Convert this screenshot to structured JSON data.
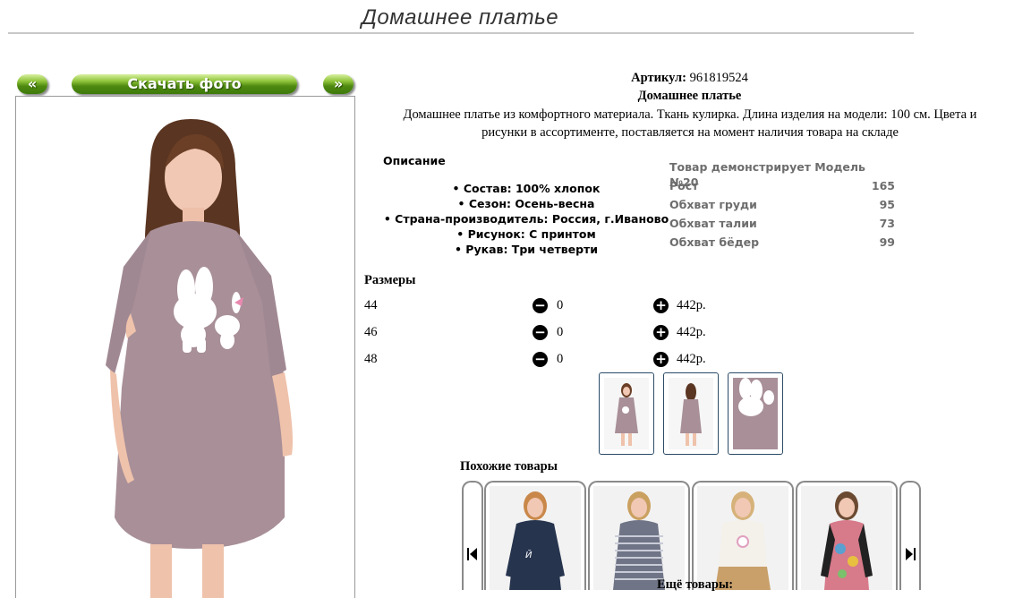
{
  "page": {
    "title": "Домашнее платье"
  },
  "photo_nav": {
    "prev_label": "«",
    "download_label": "Скачать фото",
    "next_label": "»"
  },
  "product": {
    "article_label": "Артикул:",
    "article_value": "961819524",
    "name": "Домашнее платье",
    "description_line1": "Домашнее платье из комфортного материала. Ткань кулирка. Длина изделия на модели: 100 см. Цвета и",
    "description_line2": "рисунки в ассортименте, поставляется на момент наличия товара на складе"
  },
  "specs": {
    "heading": "Описание",
    "items": [
      "• Состав: 100% хлопок",
      "• Сезон: Осень-весна",
      "• Страна-производитель: Россия, г.Иваново",
      "• Рисунок: С принтом",
      "• Рукав: Три четверти"
    ]
  },
  "model": {
    "heading": "Товар демонстрирует Модель №20",
    "rows": [
      {
        "label": "Рост",
        "value": "165"
      },
      {
        "label": "Обхват груди",
        "value": "95"
      },
      {
        "label": "Обхват талии",
        "value": "73"
      },
      {
        "label": "Обхват бёдер",
        "value": "99"
      }
    ]
  },
  "sizes": {
    "heading": "Размеры",
    "rows": [
      {
        "size": "44",
        "qty": "0",
        "price": "442р."
      },
      {
        "size": "46",
        "qty": "0",
        "price": "442р."
      },
      {
        "size": "48",
        "qty": "0",
        "price": "442р."
      }
    ],
    "minus_icon": "minus-circle-icon",
    "plus_icon": "plus-circle-icon"
  },
  "similar": {
    "heading": "Похожие товары",
    "prev_icon": "skip-back-icon",
    "next_icon": "skip-forward-icon"
  },
  "more_label": "Ещё товары:",
  "colors": {
    "accent_green": "#5a9a1a",
    "dress": "#a88f98",
    "thumb_border": "#2a4a66"
  }
}
